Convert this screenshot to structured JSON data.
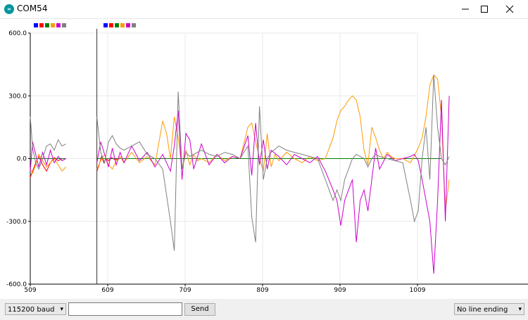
{
  "window": {
    "title": "COM54",
    "icon": "arduino-logo-icon",
    "controls": [
      "minimize-icon",
      "maximize-icon",
      "close-icon"
    ]
  },
  "chart_data": {
    "type": "line",
    "title": "",
    "xlabel": "",
    "ylabel": "",
    "ylim": [
      -600,
      600
    ],
    "xlim": [
      509,
      1009
    ],
    "y_tick_labels": [
      "600.0",
      "300.0",
      "0.0",
      "-300.0",
      "-600.0"
    ],
    "y_ticks": [
      600,
      300,
      0,
      -300,
      -600
    ],
    "x_tick_labels": [
      "509",
      "609",
      "709",
      "809",
      "909",
      "1009"
    ],
    "x_ticks": [
      509,
      609,
      709,
      809,
      909,
      1009
    ],
    "grid": true,
    "legend_placement": "top-left",
    "legend_colors": [
      "#0000ff",
      "#ff0000",
      "#008000",
      "#ff9900",
      "#cc00cc",
      "#808080"
    ],
    "divider_x": 595,
    "series": [
      {
        "color": "#0000ff",
        "x": [
          509,
          555,
          555,
          595,
          595,
          680,
          700,
          760,
          800,
          860,
          900,
          960,
          1000,
          1040
        ],
        "y": [
          0,
          0,
          null,
          null,
          0,
          0,
          0,
          0,
          0,
          0,
          0,
          0,
          0,
          0
        ]
      },
      {
        "color": "#ff0000",
        "x": [
          509,
          512,
          516,
          520,
          525,
          530,
          535,
          540,
          545,
          550,
          555,
          555,
          595,
          595,
          598,
          601,
          604,
          607,
          610,
          614,
          618,
          625,
          640,
          660,
          680,
          700,
          720,
          740,
          760,
          780,
          800,
          820,
          840,
          860,
          880,
          900,
          920,
          940,
          960,
          980,
          1000,
          1020,
          1040
        ],
        "y": [
          -90,
          -60,
          -20,
          10,
          -30,
          -60,
          -20,
          5,
          -10,
          0,
          0,
          null,
          null,
          -60,
          -30,
          10,
          -20,
          0,
          -10,
          5,
          -5,
          0,
          0,
          0,
          0,
          0,
          0,
          0,
          0,
          0,
          0,
          0,
          0,
          0,
          0,
          0,
          0,
          0,
          0,
          0,
          0,
          0,
          0
        ]
      },
      {
        "color": "#008000",
        "x": [
          509,
          555,
          555,
          595,
          595,
          700,
          760,
          820,
          900,
          960,
          1000,
          1040
        ],
        "y": [
          0,
          0,
          null,
          null,
          0,
          0,
          0,
          0,
          0,
          0,
          0,
          0
        ]
      },
      {
        "color": "#ff9900",
        "x": [
          509,
          512,
          516,
          520,
          525,
          530,
          535,
          540,
          545,
          550,
          555,
          555,
          595,
          595,
          600,
          605,
          610,
          615,
          620,
          625,
          630,
          640,
          650,
          660,
          670,
          680,
          685,
          690,
          695,
          700,
          705,
          710,
          715,
          720,
          725,
          730,
          740,
          750,
          760,
          770,
          780,
          790,
          795,
          800,
          805,
          810,
          815,
          820,
          825,
          830,
          840,
          850,
          860,
          870,
          880,
          890,
          900,
          905,
          910,
          915,
          920,
          925,
          930,
          935,
          940,
          945,
          950,
          955,
          960,
          965,
          970,
          975,
          980,
          990,
          1000,
          1010,
          1015,
          1020,
          1025,
          1030,
          1035,
          1040,
          1045,
          1050
        ],
        "y": [
          -50,
          -70,
          -30,
          20,
          -10,
          -40,
          -20,
          0,
          -30,
          -60,
          -40,
          null,
          null,
          -50,
          -10,
          20,
          -30,
          -50,
          -10,
          10,
          -20,
          30,
          -20,
          10,
          -30,
          180,
          120,
          0,
          200,
          100,
          -50,
          40,
          -30,
          20,
          -10,
          0,
          -20,
          20,
          -10,
          10,
          0,
          150,
          170,
          80,
          0,
          -60,
          120,
          -40,
          20,
          -10,
          30,
          0,
          -20,
          10,
          -10,
          0,
          100,
          180,
          230,
          250,
          280,
          300,
          280,
          200,
          40,
          -30,
          150,
          100,
          40,
          0,
          30,
          10,
          0,
          0,
          -20,
          50,
          100,
          200,
          350,
          400,
          380,
          200,
          -250,
          -100
        ]
      },
      {
        "color": "#cc00cc",
        "x": [
          509,
          512,
          516,
          520,
          525,
          530,
          535,
          540,
          545,
          550,
          555,
          555,
          595,
          595,
          600,
          605,
          610,
          615,
          620,
          625,
          630,
          640,
          650,
          660,
          670,
          680,
          690,
          695,
          700,
          705,
          710,
          715,
          720,
          730,
          740,
          750,
          760,
          770,
          780,
          790,
          795,
          800,
          805,
          810,
          815,
          820,
          830,
          840,
          850,
          860,
          870,
          880,
          890,
          900,
          905,
          910,
          915,
          920,
          925,
          930,
          935,
          940,
          945,
          950,
          955,
          960,
          970,
          980,
          990,
          1000,
          1005,
          1010,
          1015,
          1020,
          1025,
          1030,
          1035,
          1040,
          1045,
          1050
        ],
        "y": [
          -60,
          80,
          20,
          -40,
          30,
          -30,
          40,
          -20,
          10,
          -10,
          0,
          null,
          null,
          -20,
          80,
          20,
          -40,
          50,
          -30,
          30,
          -20,
          60,
          -10,
          30,
          -40,
          20,
          -60,
          60,
          230,
          -100,
          120,
          90,
          -50,
          70,
          -30,
          20,
          -20,
          10,
          0,
          110,
          -80,
          170,
          -30,
          90,
          -50,
          40,
          10,
          -30,
          20,
          0,
          -20,
          10,
          -60,
          -150,
          -200,
          -320,
          -200,
          -150,
          -100,
          -400,
          -200,
          -150,
          -250,
          -100,
          50,
          -50,
          20,
          -10,
          0,
          10,
          20,
          -10,
          -100,
          -200,
          -300,
          -550,
          -200,
          280,
          -300,
          300
        ]
      },
      {
        "color": "#808080",
        "x": [
          509,
          512,
          516,
          520,
          525,
          530,
          535,
          540,
          545,
          550,
          555,
          555,
          595,
          595,
          600,
          605,
          610,
          615,
          620,
          625,
          630,
          640,
          650,
          660,
          670,
          680,
          690,
          695,
          700,
          705,
          710,
          715,
          720,
          730,
          740,
          750,
          760,
          770,
          780,
          790,
          795,
          800,
          805,
          810,
          815,
          820,
          830,
          840,
          850,
          860,
          870,
          880,
          890,
          900,
          905,
          910,
          915,
          920,
          925,
          930,
          935,
          940,
          945,
          950,
          955,
          960,
          970,
          980,
          990,
          1000,
          1005,
          1010,
          1015,
          1020,
          1025,
          1030,
          1035,
          1040,
          1045,
          1050
        ],
        "y": [
          200,
          50,
          -20,
          -50,
          0,
          60,
          70,
          40,
          90,
          60,
          70,
          null,
          null,
          200,
          30,
          -20,
          80,
          110,
          70,
          50,
          40,
          60,
          80,
          20,
          0,
          -50,
          -300,
          -440,
          320,
          -50,
          30,
          10,
          20,
          40,
          20,
          10,
          30,
          20,
          0,
          60,
          -280,
          -400,
          250,
          -100,
          0,
          30,
          60,
          40,
          30,
          20,
          10,
          0,
          -100,
          -200,
          -150,
          -200,
          -100,
          -50,
          0,
          20,
          10,
          0,
          -40,
          0,
          20,
          10,
          0,
          -10,
          -20,
          -200,
          -300,
          -250,
          0,
          150,
          -100,
          400,
          150,
          0,
          -30,
          10
        ]
      }
    ]
  },
  "bottom": {
    "baud_select": "115200 baud",
    "message_input": "",
    "send_label": "Send",
    "line_ending_select": "No line ending"
  }
}
